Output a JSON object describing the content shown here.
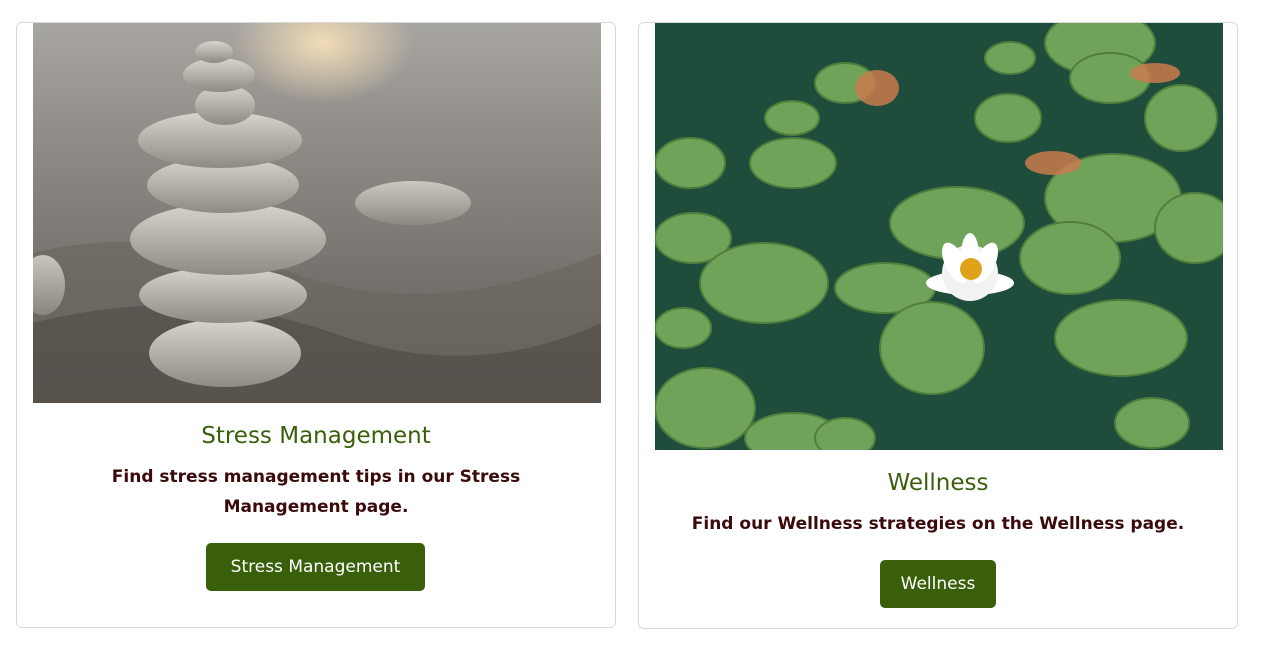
{
  "cards": [
    {
      "title": "Stress Management",
      "text": "Find stress management tips in our Stress Management page.",
      "button_label": "Stress Management",
      "image": "stacked-stones-on-sand-photo"
    },
    {
      "title": "Wellness",
      "text": "Find our Wellness strategies on the Wellness page.",
      "button_label": "Wellness",
      "image": "water-lily-on-pond-photo"
    }
  ],
  "colors": {
    "accent": "#3a5f0b",
    "body_text": "#3b0a0a",
    "button_text": "#ffffff",
    "card_border": "#d9d9d9"
  }
}
